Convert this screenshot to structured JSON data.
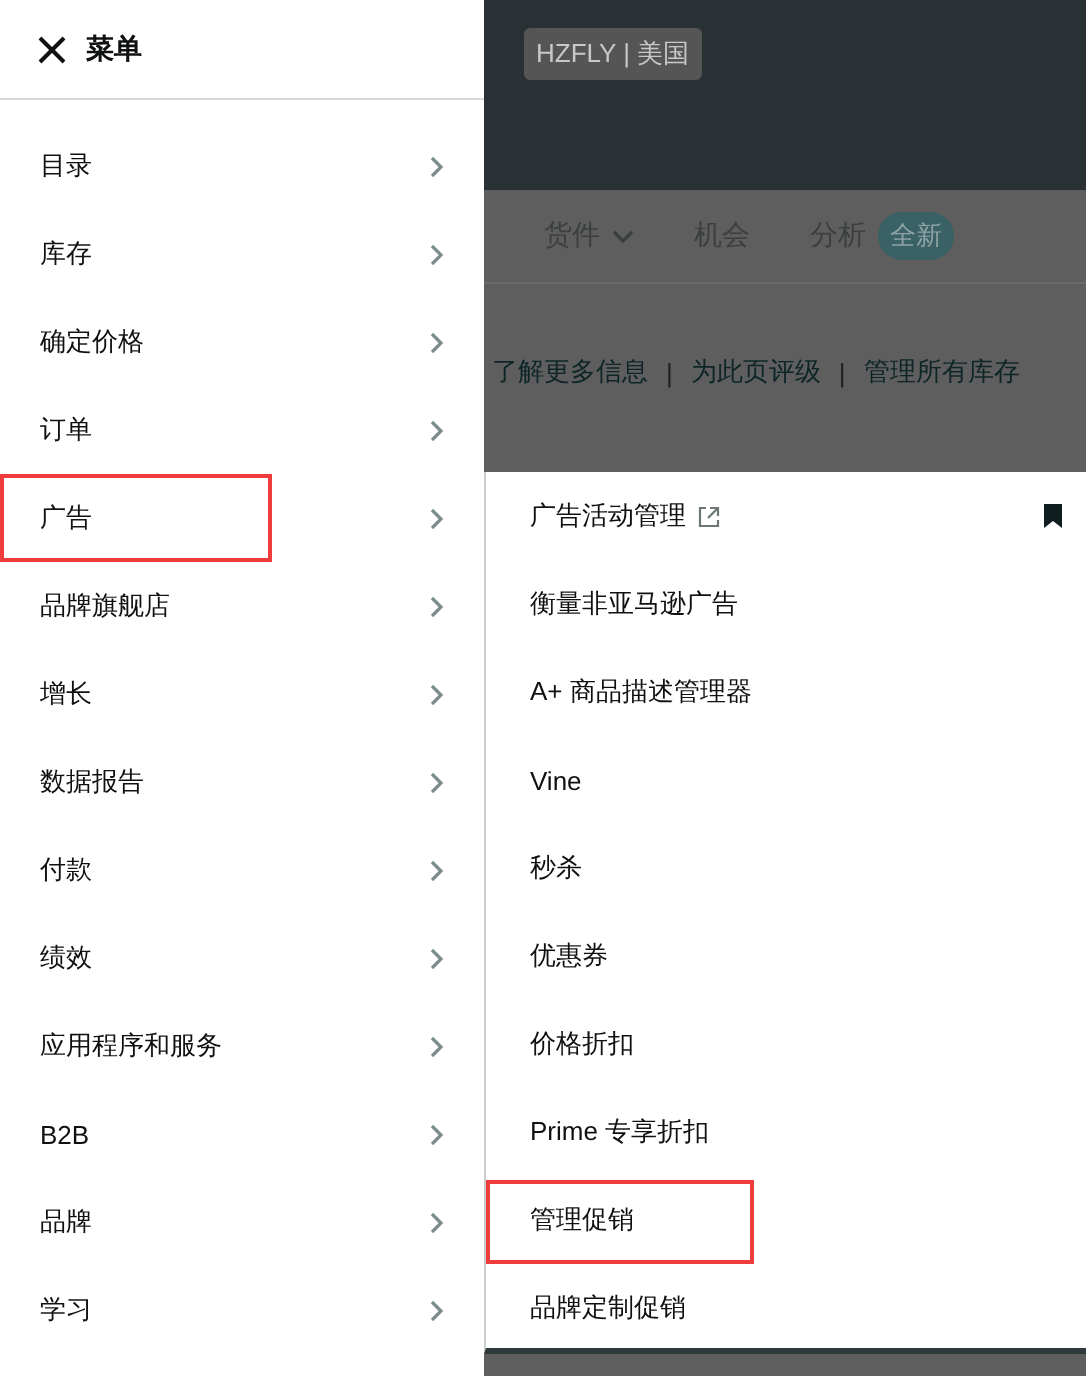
{
  "background": {
    "account": "HZFLY | 美国",
    "nav": [
      {
        "label": "货件",
        "kind": "dropdown"
      },
      {
        "label": "机会",
        "kind": "plain"
      },
      {
        "label": "分析",
        "kind": "badge",
        "badge": "全新"
      }
    ],
    "links": [
      {
        "kind": "link",
        "label": "了解更多信息"
      },
      {
        "kind": "separator",
        "label": "|"
      },
      {
        "kind": "link",
        "label": "为此页评级"
      },
      {
        "kind": "separator",
        "label": "|"
      },
      {
        "kind": "link",
        "label": "管理所有库存"
      }
    ]
  },
  "menu": {
    "title": "菜单",
    "items": [
      {
        "label": "目录",
        "highlighted": false
      },
      {
        "label": "库存",
        "highlighted": false
      },
      {
        "label": "确定价格",
        "highlighted": false
      },
      {
        "label": "订单",
        "highlighted": false
      },
      {
        "label": "广告",
        "highlighted": true
      },
      {
        "label": "品牌旗舰店",
        "highlighted": false
      },
      {
        "label": "增长",
        "highlighted": false
      },
      {
        "label": "数据报告",
        "highlighted": false
      },
      {
        "label": "付款",
        "highlighted": false
      },
      {
        "label": "绩效",
        "highlighted": false
      },
      {
        "label": "应用程序和服务",
        "highlighted": false
      },
      {
        "label": "B2B",
        "highlighted": false
      },
      {
        "label": "品牌",
        "highlighted": false
      },
      {
        "label": "学习",
        "highlighted": false
      }
    ]
  },
  "submenu": {
    "items": [
      {
        "label": "广告活动管理",
        "external": true,
        "bookmarked": true,
        "highlighted": false
      },
      {
        "label": "衡量非亚马逊广告",
        "external": false,
        "bookmarked": false,
        "highlighted": false
      },
      {
        "label": "A+ 商品描述管理器",
        "external": false,
        "bookmarked": false,
        "highlighted": false
      },
      {
        "label": "Vine",
        "external": false,
        "bookmarked": false,
        "highlighted": false
      },
      {
        "label": "秒杀",
        "external": false,
        "bookmarked": false,
        "highlighted": false
      },
      {
        "label": "优惠券",
        "external": false,
        "bookmarked": false,
        "highlighted": false
      },
      {
        "label": "价格折扣",
        "external": false,
        "bookmarked": false,
        "highlighted": false
      },
      {
        "label": "Prime 专享折扣",
        "external": false,
        "bookmarked": false,
        "highlighted": false
      },
      {
        "label": "管理促销",
        "external": false,
        "bookmarked": false,
        "highlighted": true
      },
      {
        "label": "品牌定制促销",
        "external": false,
        "bookmarked": false,
        "highlighted": false
      }
    ]
  }
}
